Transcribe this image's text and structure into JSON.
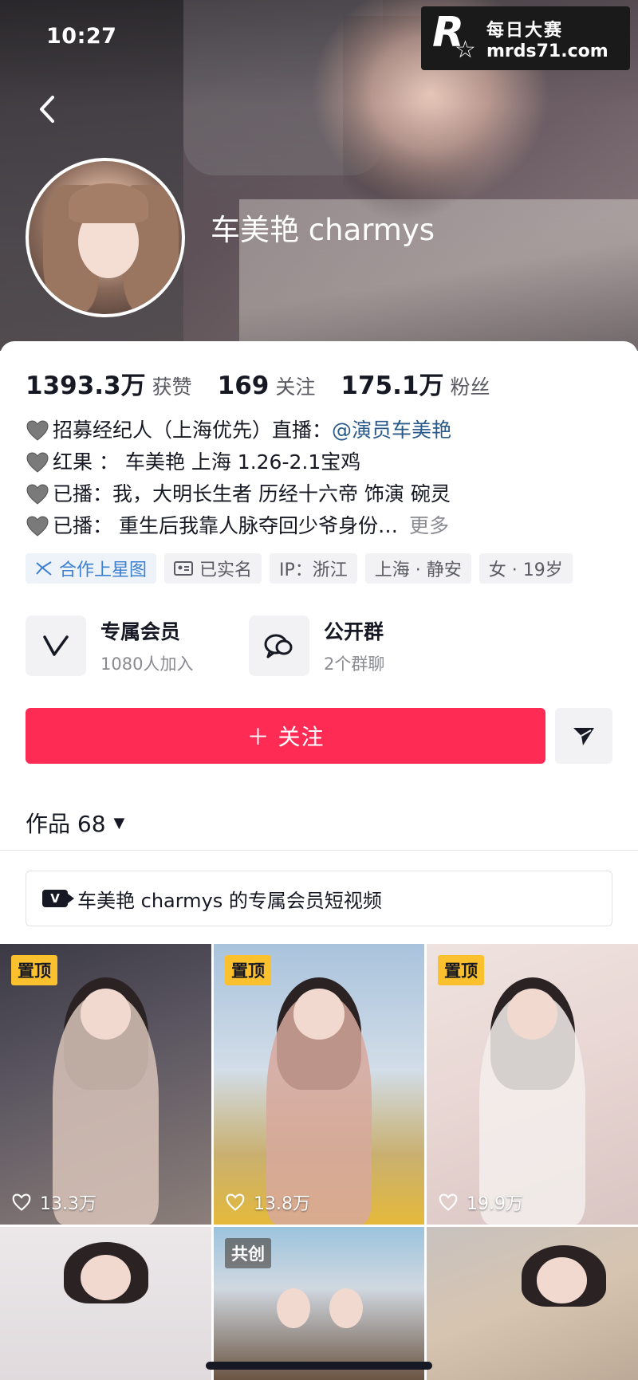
{
  "status_bar": {
    "time": "10:27"
  },
  "watermark": {
    "logo_letter": "R",
    "title": "每日大赛",
    "url": "mrds71.com"
  },
  "profile": {
    "username": "车美艳 charmys",
    "stats": [
      {
        "value": "1393.3万",
        "label": "获赞"
      },
      {
        "value": "169",
        "label": "关注"
      },
      {
        "value": "175.1万",
        "label": "粉丝"
      }
    ],
    "bio": {
      "line1_text": "招募经纪人（上海优先）直播：",
      "line1_mention": "@演员车美艳",
      "line2": "红果 ： 车美艳 上海  1.26-2.1宝鸡",
      "line3": "已播：我，大明长生者 历经十六帝 饰演 碗灵",
      "line4": "已播： 重生后我靠人脉夺回少爷身份…",
      "more": "更多"
    },
    "tags": [
      {
        "label": "合作上星图",
        "icon": "star-map-icon"
      },
      {
        "label": "已实名",
        "icon": "id-card-icon"
      },
      {
        "label": "IP：浙江"
      },
      {
        "label": "上海 · 静安"
      },
      {
        "label": "女 · 19岁"
      }
    ],
    "cards": [
      {
        "title": "专属会员",
        "subtitle": "1080人加入",
        "icon": "vip-v-icon"
      },
      {
        "title": "公开群",
        "subtitle": "2个群聊",
        "icon": "group-chat-icon"
      }
    ],
    "follow_label": "＋ 关注",
    "works_label": "作品 68",
    "member_videos_label": "车美艳 charmys 的专属会员短视频"
  },
  "videos": [
    {
      "badge": "置顶",
      "likes": "13.3万"
    },
    {
      "badge": "置顶",
      "likes": "13.8万"
    },
    {
      "badge": "置顶",
      "likes": "19.9万"
    },
    {
      "badge": "",
      "likes": ""
    },
    {
      "badge": "共创",
      "likes": ""
    },
    {
      "badge": "",
      "likes": ""
    }
  ],
  "colors": {
    "accent": "#fe2c55",
    "pin_badge": "#fbc02d",
    "link": "#2a5a8a"
  }
}
